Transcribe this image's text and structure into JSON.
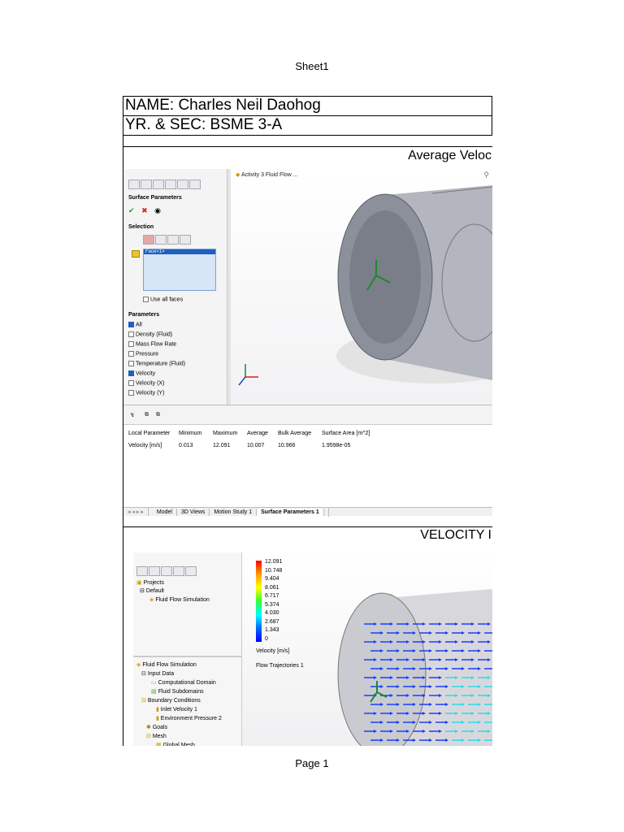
{
  "page": {
    "header": "Sheet1",
    "footer": "Page 1"
  },
  "sheet": {
    "name_row": "NAME: Charles Neil Daohog",
    "section_row": "YR. & SEC: BSME 3-A",
    "section1_title": "Average Veloc",
    "section2_title": "VELOCITY I"
  },
  "screenshot1": {
    "breadcrumb": "Activity 3 Fluid Flow ...",
    "panel_title": "Surface Parameters",
    "selection_label": "Selection",
    "selected_face": "Face<1>",
    "use_all_faces": "Use all faces",
    "parameters_label": "Parameters",
    "parameters": [
      {
        "label": "All",
        "checked": true
      },
      {
        "label": "Density (Fluid)",
        "checked": false
      },
      {
        "label": "Mass Flow Rate",
        "checked": false
      },
      {
        "label": "Pressure",
        "checked": false
      },
      {
        "label": "Temperature (Fluid)",
        "checked": false
      },
      {
        "label": "Velocity",
        "checked": true
      },
      {
        "label": "Velocity (X)",
        "checked": false
      },
      {
        "label": "Velocity (Y)",
        "checked": false
      }
    ],
    "table_headers": [
      "Local Parameter",
      "Minimum",
      "Maximum",
      "Average",
      "Bulk Average",
      "Surface Area [m^2]"
    ],
    "table_row": [
      "Velocity [m/s]",
      "0.013",
      "12.091",
      "10.007",
      "10.966",
      "1.9598e-05"
    ],
    "tabs": [
      "Model",
      "3D Views",
      "Motion Study 1",
      "Surface Parameters 1"
    ],
    "active_tab": "Surface Parameters 1"
  },
  "screenshot2": {
    "tree_top": {
      "projects": "Projects",
      "default": "Default",
      "fluid_flow": "Fluid Flow Simulation"
    },
    "tree_bottom": [
      "Fluid Flow Simulation",
      "Input Data",
      "Computational Domain",
      "Fluid Subdomains",
      "Boundary Conditions",
      "Inlet Velocity 1",
      "Environment Pressure 2",
      "Goals",
      "Mesh",
      "Global Mesh"
    ],
    "legend_values": [
      "12.091",
      "10.748",
      "9.404",
      "8.061",
      "6.717",
      "5.374",
      "4.030",
      "2.687",
      "1.343",
      "0"
    ],
    "legend_unit": "Velocity [m/s]",
    "plot_name": "Flow Trajectories 1"
  },
  "colors": {
    "selection_blue": "#1f5fbf",
    "legend_top": "#ff0000",
    "legend_bottom": "#0000ff"
  }
}
